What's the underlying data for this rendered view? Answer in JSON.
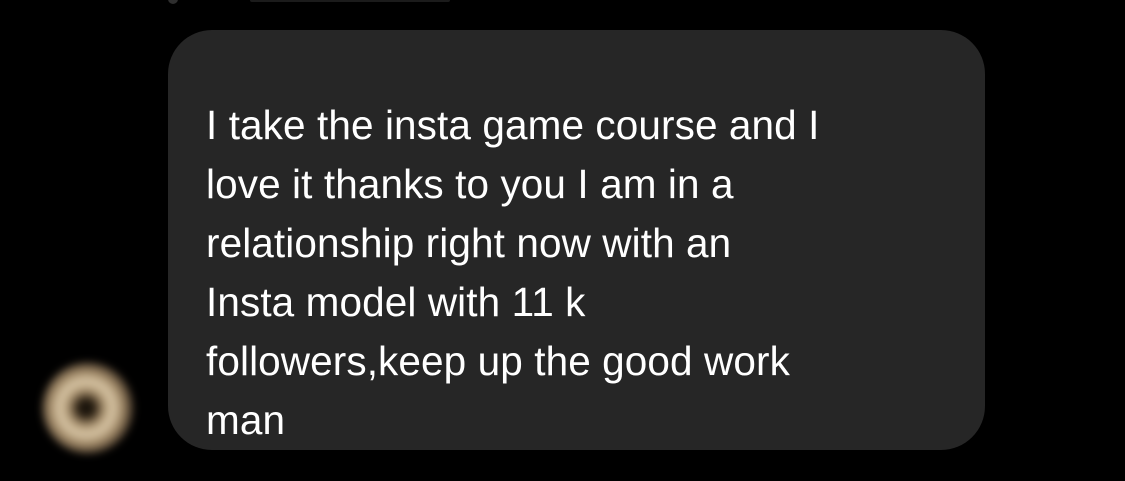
{
  "conversation": {
    "avatar_icon": "blurred-profile-avatar",
    "message": {
      "lines": [
        "I take the insta game course and I",
        "love it thanks to you I am in a",
        "relationship right now with an",
        "Insta model with 11 k",
        "followers,keep up the good work",
        "man"
      ]
    }
  },
  "colors": {
    "background": "#000000",
    "bubble": "#262626",
    "text": "#ffffff"
  }
}
